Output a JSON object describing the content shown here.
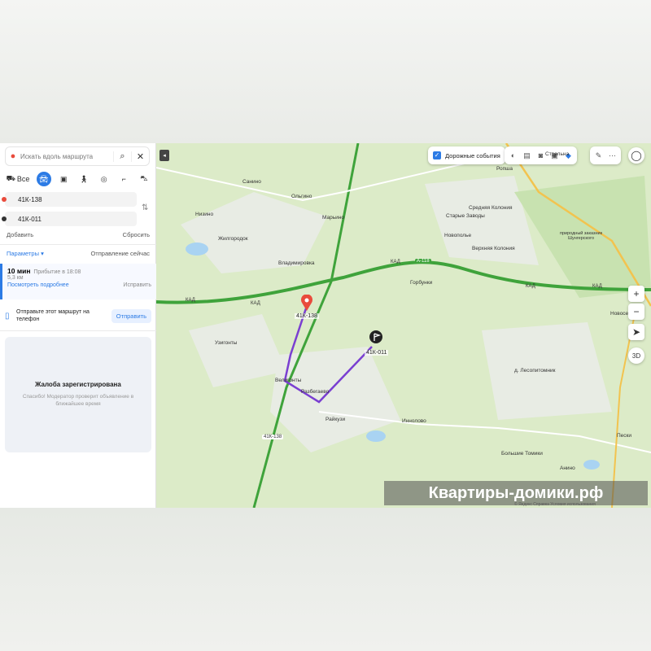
{
  "panel": {
    "search_placeholder": "Искать вдоль маршрута",
    "modes": [
      {
        "id": "all",
        "label": "Все",
        "icon": "car-outline-icon"
      },
      {
        "id": "car",
        "label": "",
        "icon": "car-icon",
        "active": true
      },
      {
        "id": "bus",
        "label": "",
        "icon": "bus-icon"
      },
      {
        "id": "walk",
        "label": "",
        "icon": "walk-icon"
      },
      {
        "id": "bike",
        "label": "",
        "icon": "bike-icon"
      },
      {
        "id": "scooter",
        "label": "",
        "icon": "scooter-icon"
      },
      {
        "id": "taxi",
        "label": "",
        "icon": "taxi-icon"
      }
    ],
    "point_a": "41К-138",
    "point_b": "41К-011",
    "add_label": "Добавить",
    "reset_label": "Сбросить",
    "params_label": "Параметры",
    "departure_label": "Отправление сейчас",
    "route": {
      "time": "10 мин",
      "arrival": "Прибытие в 18:08",
      "distance": "5,3 км",
      "details_link": "Посмотреть подробнее",
      "fix_label": "Исправить"
    },
    "send": {
      "text": "Отправьте этот маршрут на телефон",
      "button": "Отправить"
    },
    "complaint": {
      "title": "Жалоба зарегистрирована",
      "text": "Спасибо! Модератор проверит объявление в ближайшее время"
    }
  },
  "map": {
    "traffic_label": "Дорожные события",
    "places": [
      {
        "text": "Низино"
      },
      {
        "text": "Санино"
      },
      {
        "text": "Ольгино"
      },
      {
        "text": "Марьино"
      },
      {
        "text": "Жилгородок"
      },
      {
        "text": "Владимировка"
      },
      {
        "text": "Старые Заводы"
      },
      {
        "text": "Средняя Колония"
      },
      {
        "text": "Новополье"
      },
      {
        "text": "Верхняя Колония"
      },
      {
        "text": "Горбунки"
      },
      {
        "text": "Узигонты"
      },
      {
        "text": "Велигонты"
      },
      {
        "text": "Разбегаево"
      },
      {
        "text": "Райкузи"
      },
      {
        "text": "Иннолово"
      },
      {
        "text": "Стрельна"
      },
      {
        "text": "Ропша"
      },
      {
        "text": "д. Лесопитомник"
      },
      {
        "text": "Большие Томики"
      },
      {
        "text": "Пески"
      },
      {
        "text": "Новосе"
      },
      {
        "text": "Анино"
      },
      {
        "text": "природный заказник Шунгерского"
      }
    ],
    "roads": [
      "КАД",
      "КАД",
      "КАД",
      "КАД",
      "КАД",
      "А-118",
      "41К-138"
    ],
    "marker_a": "41К-138",
    "marker_b": "41К-011",
    "zoom_in": "+",
    "zoom_out": "−",
    "three_d": "3D",
    "watermark": "Квартиры-домики.рф",
    "copyright": "© Яндекс  Справка  Условия использования"
  },
  "colors": {
    "accent": "#2c7be5",
    "route": "#7a3fd1",
    "motorway": "#3fa33b",
    "marker": "#e94b3c"
  }
}
